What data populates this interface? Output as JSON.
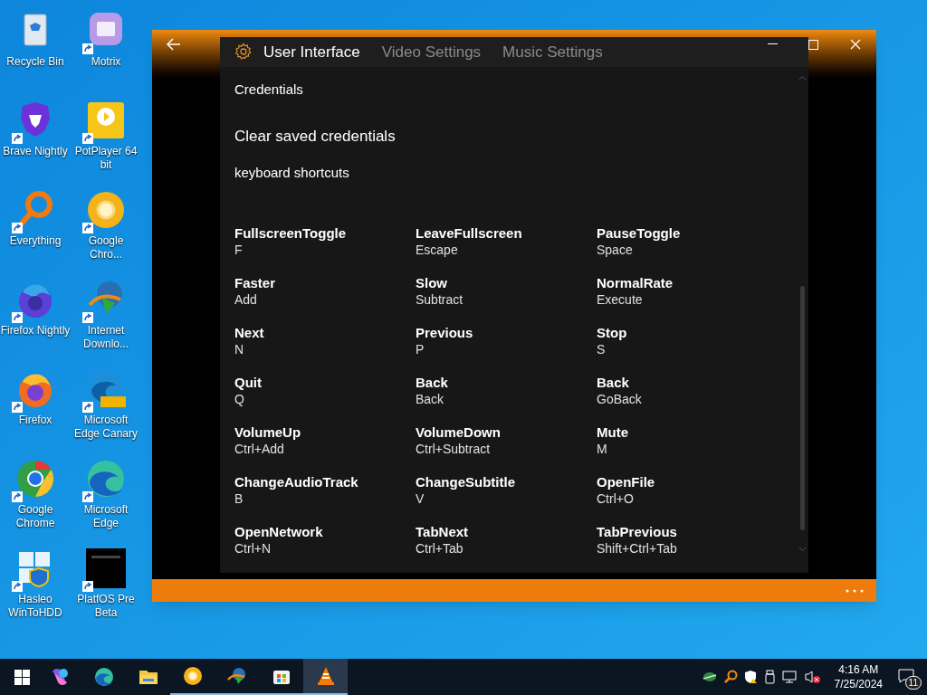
{
  "desktop_icons": [
    {
      "label": "Recycle Bin",
      "kind": "recycle",
      "shortcut": false
    },
    {
      "label": "Motrix",
      "kind": "motrix",
      "shortcut": true
    },
    {
      "label": "Brave Nightly",
      "kind": "brave",
      "shortcut": true
    },
    {
      "label": "PotPlayer 64 bit",
      "kind": "potplayer",
      "shortcut": true
    },
    {
      "label": "Everything",
      "kind": "everything",
      "shortcut": true
    },
    {
      "label": "Google Chro...",
      "kind": "canary",
      "shortcut": true
    },
    {
      "label": "Firefox Nightly",
      "kind": "firefox_nightly",
      "shortcut": true
    },
    {
      "label": "Internet Downlo...",
      "kind": "idm",
      "shortcut": true
    },
    {
      "label": "Firefox",
      "kind": "firefox",
      "shortcut": true
    },
    {
      "label": "Microsoft Edge Canary",
      "kind": "edge_canary",
      "shortcut": true
    },
    {
      "label": "Google Chrome",
      "kind": "chrome",
      "shortcut": true
    },
    {
      "label": "Microsoft Edge",
      "kind": "edge",
      "shortcut": true
    },
    {
      "label": "Hasleo WinToHDD",
      "kind": "hasleo",
      "shortcut": true
    },
    {
      "label": "PlatfOS Pre Beta",
      "kind": "platfos",
      "shortcut": true
    }
  ],
  "window": {
    "tabs": [
      {
        "label": "User Interface",
        "selected": true
      },
      {
        "label": "Video Settings",
        "selected": false
      },
      {
        "label": "Music Settings",
        "selected": false
      }
    ],
    "section_title": "Credentials",
    "clear_credentials": "Clear saved credentials",
    "shortcuts_title": "keyboard shortcuts",
    "shortcuts": [
      {
        "name": "FullscreenToggle",
        "key": "F"
      },
      {
        "name": "LeaveFullscreen",
        "key": "Escape"
      },
      {
        "name": "PauseToggle",
        "key": "Space"
      },
      {
        "name": "Faster",
        "key": "Add"
      },
      {
        "name": "Slow",
        "key": "Subtract"
      },
      {
        "name": "NormalRate",
        "key": "Execute"
      },
      {
        "name": "Next",
        "key": "N"
      },
      {
        "name": "Previous",
        "key": "P"
      },
      {
        "name": "Stop",
        "key": "S"
      },
      {
        "name": "Quit",
        "key": "Q"
      },
      {
        "name": "Back",
        "key": "Back"
      },
      {
        "name": "Back",
        "key": "GoBack"
      },
      {
        "name": "VolumeUp",
        "key": "Ctrl+Add"
      },
      {
        "name": "VolumeDown",
        "key": "Ctrl+Subtract"
      },
      {
        "name": "Mute",
        "key": "M"
      },
      {
        "name": "ChangeAudioTrack",
        "key": "B"
      },
      {
        "name": "ChangeSubtitle",
        "key": "V"
      },
      {
        "name": "OpenFile",
        "key": "Ctrl+O"
      },
      {
        "name": "OpenNetwork",
        "key": "Ctrl+N"
      },
      {
        "name": "TabNext",
        "key": "Ctrl+Tab"
      },
      {
        "name": "TabPrevious",
        "key": "Shift+Ctrl+Tab"
      }
    ]
  },
  "taskbar": {
    "apps": [
      {
        "kind": "copilot",
        "running": false,
        "selected": false
      },
      {
        "kind": "edge",
        "running": false,
        "selected": false
      },
      {
        "kind": "explorer",
        "running": false,
        "selected": false
      },
      {
        "kind": "canary",
        "running": true,
        "selected": false
      },
      {
        "kind": "idm",
        "running": true,
        "selected": false
      },
      {
        "kind": "store",
        "running": true,
        "selected": false
      },
      {
        "kind": "vlc",
        "running": true,
        "selected": true
      }
    ],
    "time": "4:16 AM",
    "date": "7/25/2024",
    "notifications": "11"
  }
}
